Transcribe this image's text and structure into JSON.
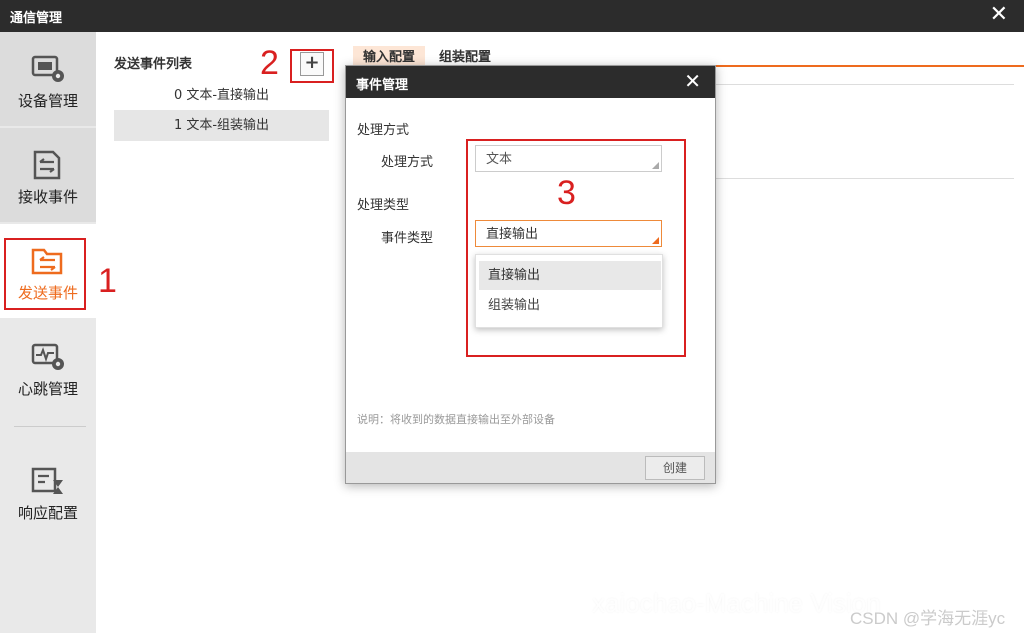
{
  "window": {
    "title": "通信管理",
    "close_icon": "✕"
  },
  "sidebar": {
    "items": [
      {
        "label": "设备管理",
        "icon": "device-settings-icon"
      },
      {
        "label": "接收事件",
        "icon": "receive-event-icon"
      },
      {
        "label": "发送事件",
        "icon": "send-event-icon",
        "active": true
      },
      {
        "label": "心跳管理",
        "icon": "heartbeat-icon"
      },
      {
        "label": "响应配置",
        "icon": "response-config-icon"
      }
    ]
  },
  "event_list": {
    "title": "发送事件列表",
    "add_symbol": "+",
    "items": [
      {
        "label": "0 文本-直接输出",
        "selected": false
      },
      {
        "label": "1 文本-组装输出",
        "selected": true
      }
    ]
  },
  "main": {
    "tabs": [
      {
        "label": "输入配置",
        "active": true
      },
      {
        "label": "组装配置"
      }
    ]
  },
  "dialog": {
    "title": "事件管理",
    "close_icon": "✕",
    "section_mode": "处理方式",
    "mode_label": "处理方式",
    "mode_value": "文本",
    "section_type": "处理类型",
    "type_label": "事件类型",
    "type_value": "直接输出",
    "dropdown_options": [
      "直接输出",
      "组装输出"
    ],
    "note": "说明：将收到的数据直接输出至外部设备",
    "create_label": "创建"
  },
  "annotations": {
    "one": "1",
    "two": "2",
    "three": "3"
  },
  "watermarks": {
    "text": "xaiochao-Machine Vision",
    "csdn": "CSDN @学海无涯yc"
  },
  "colors": {
    "accent": "#ee6b1e",
    "annotation_red": "#d92020",
    "titlebar": "#2c2c2c"
  }
}
